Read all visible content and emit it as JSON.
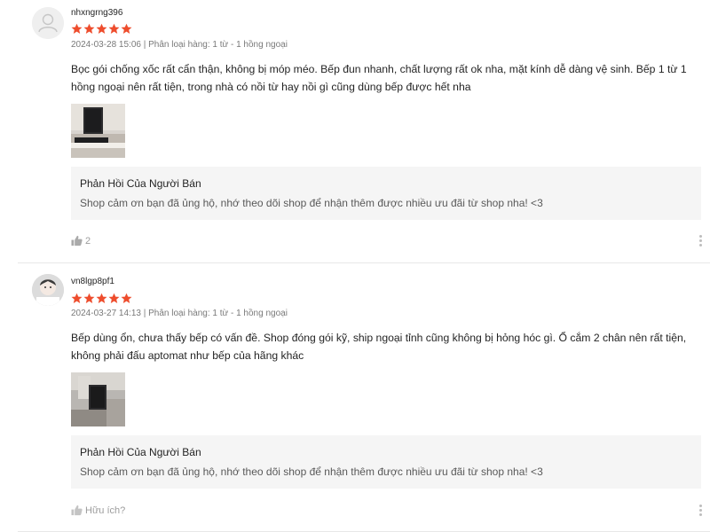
{
  "colors": {
    "star": "#ee4d2d",
    "reply_bg": "#f5f5f5",
    "muted": "#999999"
  },
  "reviews": [
    {
      "username": "nhxngrng396",
      "rating": 5,
      "meta": "2024-03-28 15:06 | Phân loại hàng: 1 từ - 1 hồng ngoại",
      "content": "Bọc gói chống xốc rất cẩn thận, không bị móp méo. Bếp đun nhanh, chất lượng rất ok nha, mặt kính dễ dàng vệ sinh. Bếp 1 từ 1 hồng ngoại nên rất tiện, trong nhà có nồi từ hay nồi gì cũng dùng bếp được hết nha",
      "reply_title": "Phản Hồi Của Người Bán",
      "reply_text": "Shop cảm ơn bạn đã ủng hộ, nhớ theo dõi shop để nhận thêm được nhiều ưu đãi từ shop nha! <3",
      "like_label": "2"
    },
    {
      "username": "vn8lgp8pf1",
      "rating": 5,
      "meta": "2024-03-27 14:13 | Phân loại hàng: 1 từ - 1 hồng ngoại",
      "content": "Bếp dùng ổn, chưa thấy bếp có vấn đề. Shop đóng gói kỹ, ship ngoại tỉnh cũng không bị hỏng hóc gì. Ổ cắm 2 chân nên rất tiện, không phải đấu aptomat như bếp của hãng khác",
      "reply_title": "Phản Hồi Của Người Bán",
      "reply_text": "Shop cảm ơn bạn đã ủng hộ, nhớ theo dõi shop để nhận thêm được nhiều ưu đãi từ shop nha! <3",
      "like_label": "Hữu ích?"
    }
  ]
}
